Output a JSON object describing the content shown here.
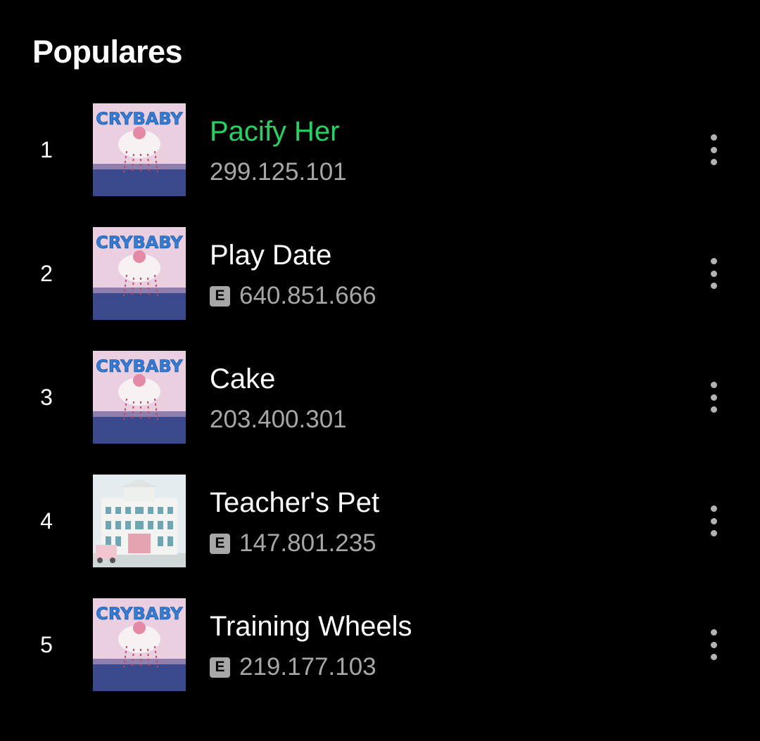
{
  "section": {
    "title": "Populares"
  },
  "colors": {
    "background": "#000000",
    "active_track": "#1ed760",
    "text_primary": "#ffffff",
    "text_secondary": "#a7a7a7"
  },
  "tracks": [
    {
      "index": "1",
      "title": "Pacify Her",
      "plays": "299.125.101",
      "explicit": false,
      "active": true,
      "cover": "crybaby-album-cover"
    },
    {
      "index": "2",
      "title": "Play Date",
      "plays": "640.851.666",
      "explicit": true,
      "explicit_label": "E",
      "active": false,
      "cover": "crybaby-album-cover"
    },
    {
      "index": "3",
      "title": "Cake",
      "plays": "203.400.301",
      "explicit": false,
      "active": false,
      "cover": "crybaby-album-cover"
    },
    {
      "index": "4",
      "title": "Teacher's Pet",
      "plays": "147.801.235",
      "explicit": true,
      "explicit_label": "E",
      "active": false,
      "cover": "k12-album-cover"
    },
    {
      "index": "5",
      "title": "Training Wheels",
      "plays": "219.177.103",
      "explicit": true,
      "explicit_label": "E",
      "active": false,
      "cover": "crybaby-album-cover"
    }
  ]
}
